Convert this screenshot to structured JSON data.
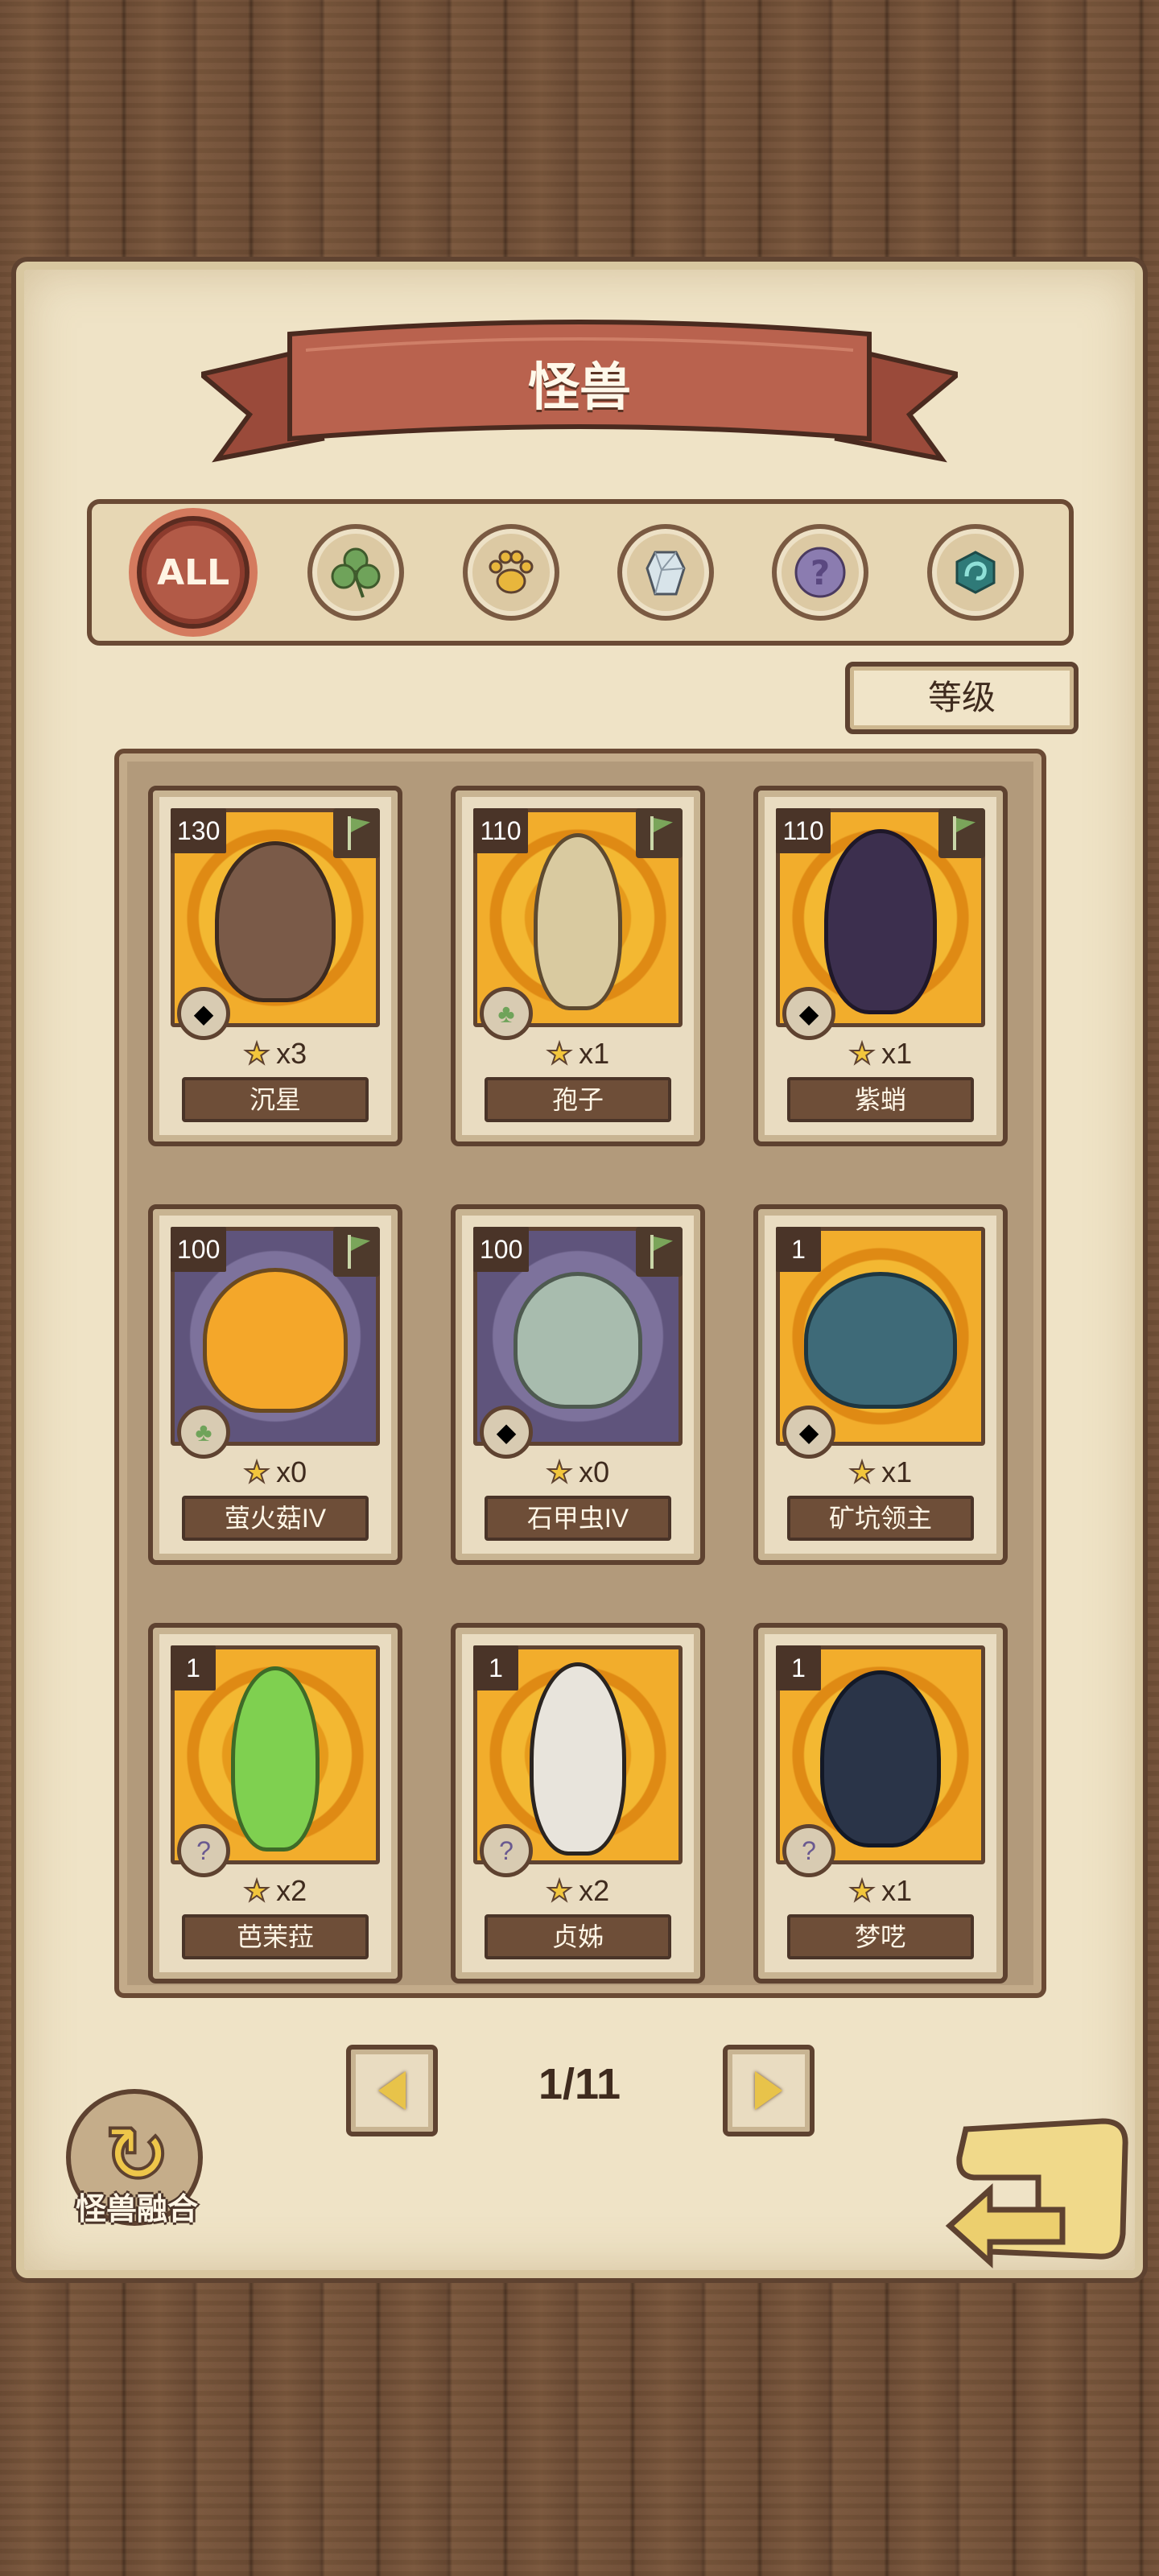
{
  "screen": {
    "title": "怪兽"
  },
  "filters": [
    {
      "id": "all",
      "label": "ALL",
      "icon": "all-icon",
      "active": true
    },
    {
      "id": "plant",
      "icon": "clover-icon",
      "active": false
    },
    {
      "id": "beast",
      "icon": "paw-icon",
      "active": false
    },
    {
      "id": "mineral",
      "icon": "crystal-icon",
      "active": false
    },
    {
      "id": "unknown",
      "icon": "question-icon",
      "active": false
    },
    {
      "id": "magic",
      "icon": "swirl-icon",
      "active": false
    }
  ],
  "sort": {
    "label": "等级"
  },
  "monsters": [
    {
      "level": "130",
      "stars": "x3",
      "name": "沉星",
      "type": "crystal-icon",
      "flag": true
    },
    {
      "level": "110",
      "stars": "x1",
      "name": "孢子",
      "type": "clover-icon",
      "flag": true
    },
    {
      "level": "110",
      "stars": "x1",
      "name": "紫蛸",
      "type": "crystal-icon",
      "flag": true
    },
    {
      "level": "100",
      "stars": "x0",
      "name": "萤火菇IV",
      "type": "clover-icon",
      "flag": true
    },
    {
      "level": "100",
      "stars": "x0",
      "name": "石甲虫IV",
      "type": "crystal-icon",
      "flag": true
    },
    {
      "level": "1",
      "stars": "x1",
      "name": "矿坑领主",
      "type": "crystal-icon",
      "flag": false
    },
    {
      "level": "1",
      "stars": "x2",
      "name": "芭茉菈",
      "type": "question-icon",
      "flag": false
    },
    {
      "level": "1",
      "stars": "x2",
      "name": "贞姊",
      "type": "question-icon",
      "flag": false
    },
    {
      "level": "1",
      "stars": "x1",
      "name": "梦呓",
      "type": "question-icon",
      "flag": false
    }
  ],
  "pager": {
    "indicator": "1/11"
  },
  "fusion": {
    "label": "怪兽融合"
  },
  "colors": {
    "banner": "#b25a47",
    "card_gold": "#f2ad2c",
    "card_purple": "#7d729c",
    "wood": "#6e4d35"
  }
}
